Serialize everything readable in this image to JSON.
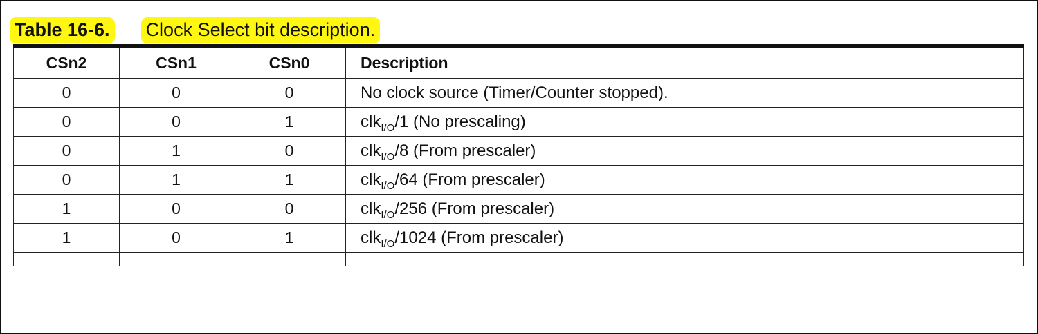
{
  "caption": {
    "number": "Table 16-6.",
    "title": "Clock Select bit description."
  },
  "table": {
    "headers": [
      "CSn2",
      "CSn1",
      "CSn0",
      "Description"
    ],
    "rows": [
      {
        "cs2": "0",
        "cs1": "0",
        "cs0": "0",
        "desc_pre": "No clock source (Timer/Counter stopped).",
        "desc_sub": "",
        "desc_post": ""
      },
      {
        "cs2": "0",
        "cs1": "0",
        "cs0": "1",
        "desc_pre": "clk",
        "desc_sub": "I/O",
        "desc_post": "/1 (No prescaling)"
      },
      {
        "cs2": "0",
        "cs1": "1",
        "cs0": "0",
        "desc_pre": "clk",
        "desc_sub": "I/O",
        "desc_post": "/8 (From prescaler)"
      },
      {
        "cs2": "0",
        "cs1": "1",
        "cs0": "1",
        "desc_pre": "clk",
        "desc_sub": "I/O",
        "desc_post": "/64 (From prescaler)"
      },
      {
        "cs2": "1",
        "cs1": "0",
        "cs0": "0",
        "desc_pre": "clk",
        "desc_sub": "I/O",
        "desc_post": "/256 (From prescaler)"
      },
      {
        "cs2": "1",
        "cs1": "0",
        "cs0": "1",
        "desc_pre": "clk",
        "desc_sub": "I/O",
        "desc_post": "/1024 (From prescaler)"
      }
    ]
  },
  "colors": {
    "highlight": "#fff70f",
    "border": "#111111"
  }
}
